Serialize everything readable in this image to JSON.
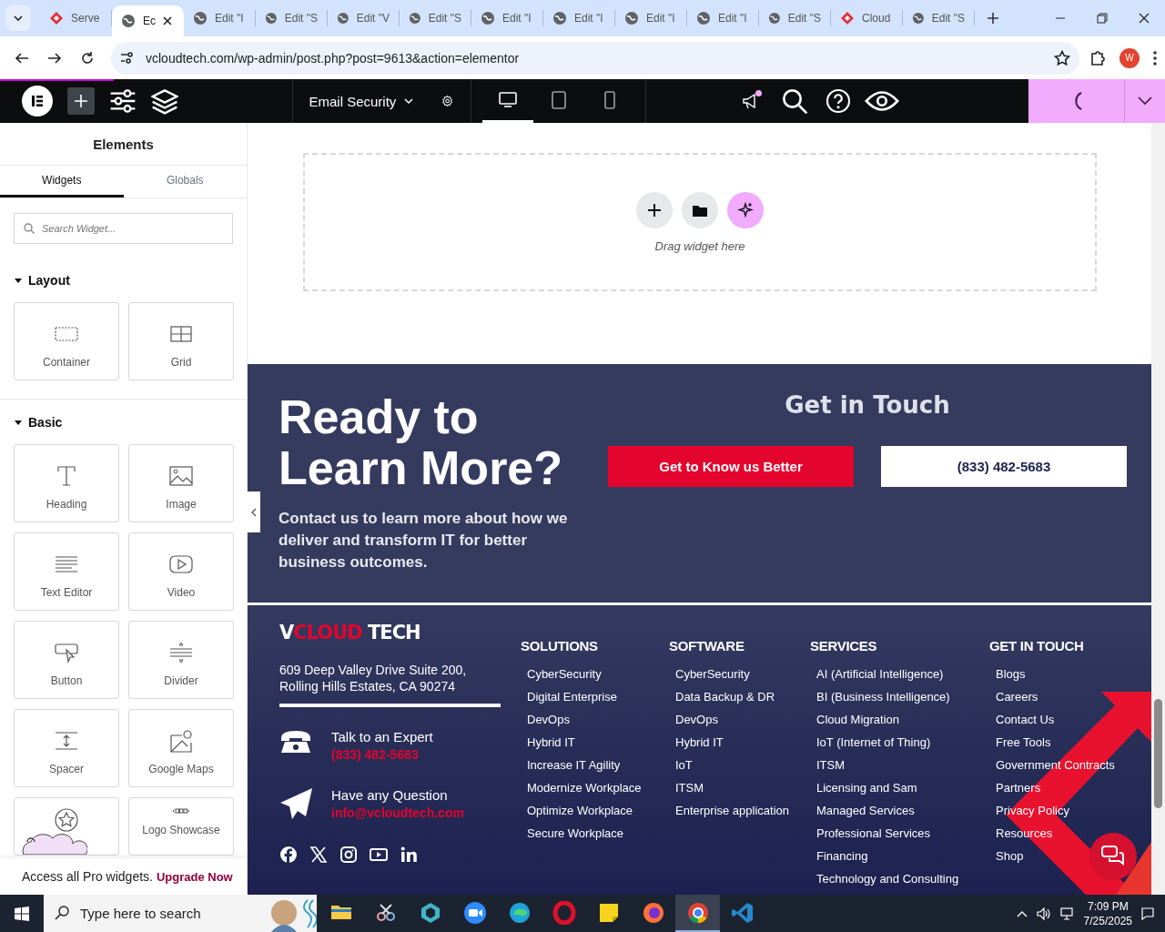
{
  "browser": {
    "tabs": [
      {
        "title": "Serve",
        "kind": "brand",
        "selected": false
      },
      {
        "title": "Ec",
        "kind": "globe",
        "selected": true
      },
      {
        "title": "Edit \"I",
        "kind": "globe",
        "selected": false
      },
      {
        "title": "Edit \"S",
        "kind": "globe",
        "selected": false
      },
      {
        "title": "Edit \"V",
        "kind": "globe",
        "selected": false
      },
      {
        "title": "Edit \"S",
        "kind": "globe",
        "selected": false
      },
      {
        "title": "Edit \"I",
        "kind": "globe",
        "selected": false
      },
      {
        "title": "Edit \"I",
        "kind": "globe",
        "selected": false
      },
      {
        "title": "Edit \"I",
        "kind": "globe",
        "selected": false
      },
      {
        "title": "Edit \"I",
        "kind": "globe",
        "selected": false
      },
      {
        "title": "Edit \"S",
        "kind": "globe",
        "selected": false
      },
      {
        "title": "Cloud",
        "kind": "brand",
        "selected": false
      },
      {
        "title": "Edit \"S",
        "kind": "globe",
        "selected": false
      }
    ],
    "url": "vcloudtech.com/wp-admin/post.php?post=9613&action=elementor",
    "profile": "W"
  },
  "editor_bar": {
    "page_title": "Email Security",
    "devices": [
      {
        "kind": "desktop",
        "selected": true
      },
      {
        "kind": "tablet",
        "selected": false
      },
      {
        "kind": "mobile",
        "selected": false
      }
    ]
  },
  "panel": {
    "title": "Elements",
    "tabs": [
      {
        "label": "Widgets",
        "selected": true
      },
      {
        "label": "Globals",
        "selected": false
      }
    ],
    "search": {
      "placeholder": "Search Widget..."
    },
    "categories": [
      {
        "name": "Layout",
        "expanded": true,
        "widgets": [
          {
            "label": "Container",
            "kind": "container"
          },
          {
            "label": "Grid",
            "kind": "grid"
          }
        ]
      },
      {
        "name": "Basic",
        "expanded": true,
        "widgets": [
          {
            "label": "Heading",
            "kind": "heading"
          },
          {
            "label": "Image",
            "kind": "image"
          },
          {
            "label": "Text Editor",
            "kind": "text"
          },
          {
            "label": "Video",
            "kind": "video"
          },
          {
            "label": "Button",
            "kind": "button"
          },
          {
            "label": "Divider",
            "kind": "divider"
          },
          {
            "label": "Spacer",
            "kind": "spacer"
          },
          {
            "label": "Google Maps",
            "kind": "map"
          },
          {
            "kind": "star"
          },
          {
            "label": "Logo Showcase",
            "kind": "logos"
          }
        ]
      }
    ],
    "promo": {
      "text": "Access all Pro widgets.",
      "link": "Upgrade Now"
    }
  },
  "canvas": {
    "drop_hint": "Drag widget here",
    "cta": {
      "heading": "Ready to Learn More?",
      "text": "Contact us to learn more about how we deliver and transform IT for better business outcomes.",
      "side_heading": "Get in Touch",
      "buttons": [
        {
          "label": "Get to Know us Better",
          "kind": "primary"
        },
        {
          "label": "(833) 482-5683",
          "kind": "secondary"
        }
      ]
    },
    "footer": {
      "logo": {
        "lead": "V",
        "accent": "CLOUD",
        "tail": "TECH"
      },
      "address": "609 Deep Valley Drive Suite 200, Rolling Hills Estates, CA 90274",
      "contacts": [
        {
          "kind": "phone",
          "label": "Talk to an Expert",
          "value": "(833) 482-5683"
        },
        {
          "kind": "mail",
          "label": "Have any Question",
          "value": "info@vcloudtech.com"
        }
      ],
      "socials": [
        {
          "kind": "facebook"
        },
        {
          "kind": "x"
        },
        {
          "kind": "instagram"
        },
        {
          "kind": "youtube"
        },
        {
          "kind": "linkedin"
        }
      ],
      "columns": [
        {
          "heading": "SOLUTIONS",
          "items": [
            "CyberSecurity",
            "Digital Enterprise",
            "DevOps",
            "Hybrid IT",
            "Increase IT Agility",
            "Modernize Workplace",
            "Optimize Workplace",
            "Secure Workplace"
          ]
        },
        {
          "heading": "SOFTWARE",
          "items": [
            "CyberSecurity",
            "Data Backup & DR",
            "DevOps",
            "Hybrid IT",
            "IoT",
            "ITSM",
            "Enterprise application"
          ]
        },
        {
          "heading": "SERVICES",
          "items": [
            "AI (Artificial Intelligence)",
            "BI (Business Intelligence)",
            "Cloud Migration",
            "IoT (Internet of Thing)",
            "ITSM",
            "Licensing and Sam",
            "Managed Services",
            "Professional Services",
            "Financing",
            "Technology and Consulting"
          ]
        },
        {
          "heading": "GET IN TOUCH",
          "items": [
            "Blogs",
            "Careers",
            "Contact Us",
            "Free Tools",
            "Government Contracts",
            "Partners",
            "Privacy Policy",
            "Resources",
            "Shop"
          ]
        }
      ]
    }
  },
  "taskbar": {
    "search": {
      "placeholder": "Type here to search"
    },
    "apps": [
      {
        "kind": "explorer",
        "active": false
      },
      {
        "kind": "snip",
        "active": false
      },
      {
        "kind": "gem",
        "active": false
      },
      {
        "kind": "zoom",
        "active": false
      },
      {
        "kind": "edge",
        "active": false
      },
      {
        "kind": "opera",
        "active": false
      },
      {
        "kind": "notes",
        "active": false
      },
      {
        "kind": "firefox",
        "active": false
      },
      {
        "kind": "chrome",
        "active": true
      },
      {
        "kind": "vscode",
        "active": false
      }
    ],
    "time": "7:09 PM",
    "date": "7/25/2025"
  }
}
